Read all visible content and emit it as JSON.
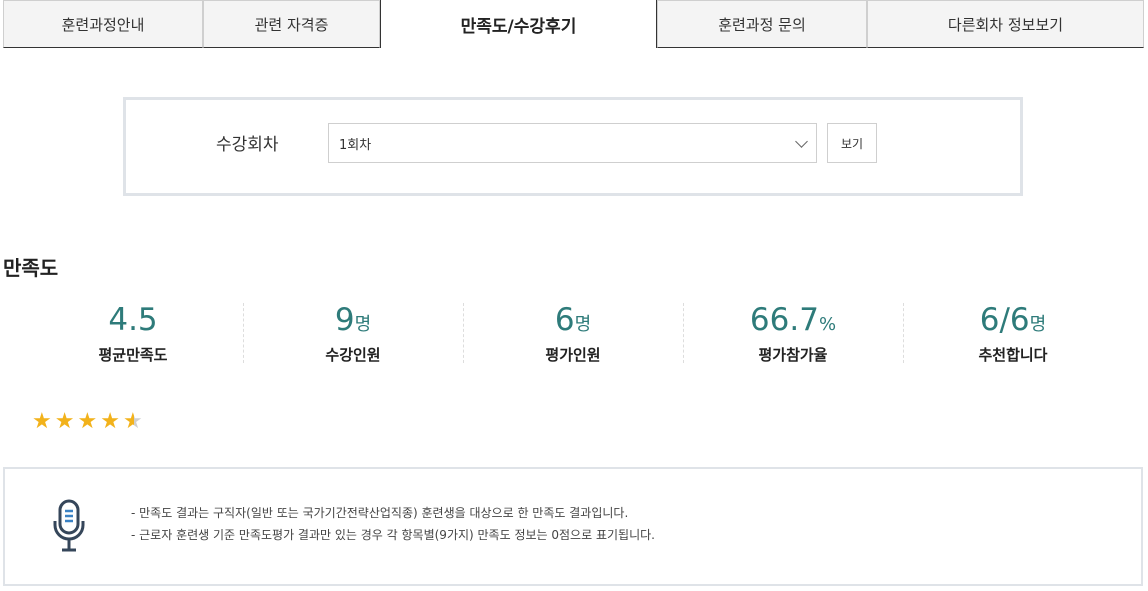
{
  "tabs": [
    {
      "label": "훈련과정안내"
    },
    {
      "label": "관련 자격증"
    },
    {
      "label": "만족도/수강후기"
    },
    {
      "label": "훈련과정 문의"
    },
    {
      "label": "다른회차 정보보기"
    }
  ],
  "filter": {
    "label": "수강회차",
    "selected": "1회차",
    "button": "보기"
  },
  "section_title": "만족도",
  "stats": [
    {
      "value": "4.5",
      "unit": "",
      "label": "평균만족도"
    },
    {
      "value": "9",
      "unit": "명",
      "label": "수강인원"
    },
    {
      "value": "6",
      "unit": "명",
      "label": "평가인원"
    },
    {
      "value": "66.7",
      "unit": "%",
      "label": "평가참가율"
    },
    {
      "value": "6/6",
      "unit": "명",
      "label": "추천합니다"
    }
  ],
  "rating": {
    "value": 4.5,
    "max": 5
  },
  "notice": {
    "icon": "microphone-icon",
    "lines": [
      "- 만족도 결과는 구직자(일반 또는 국가기간전략산업직종) 훈련생을 대상으로 한 만족도 결과입니다.",
      "- 근로자 훈련생 기준 만족도평가 결과만 있는 경우 각 항목별(9가지) 만족도 정보는 0점으로 표기됩니다."
    ]
  },
  "colors": {
    "accent": "#2e7b7a",
    "star": "#f2b21b",
    "border": "#dfe3e8"
  }
}
